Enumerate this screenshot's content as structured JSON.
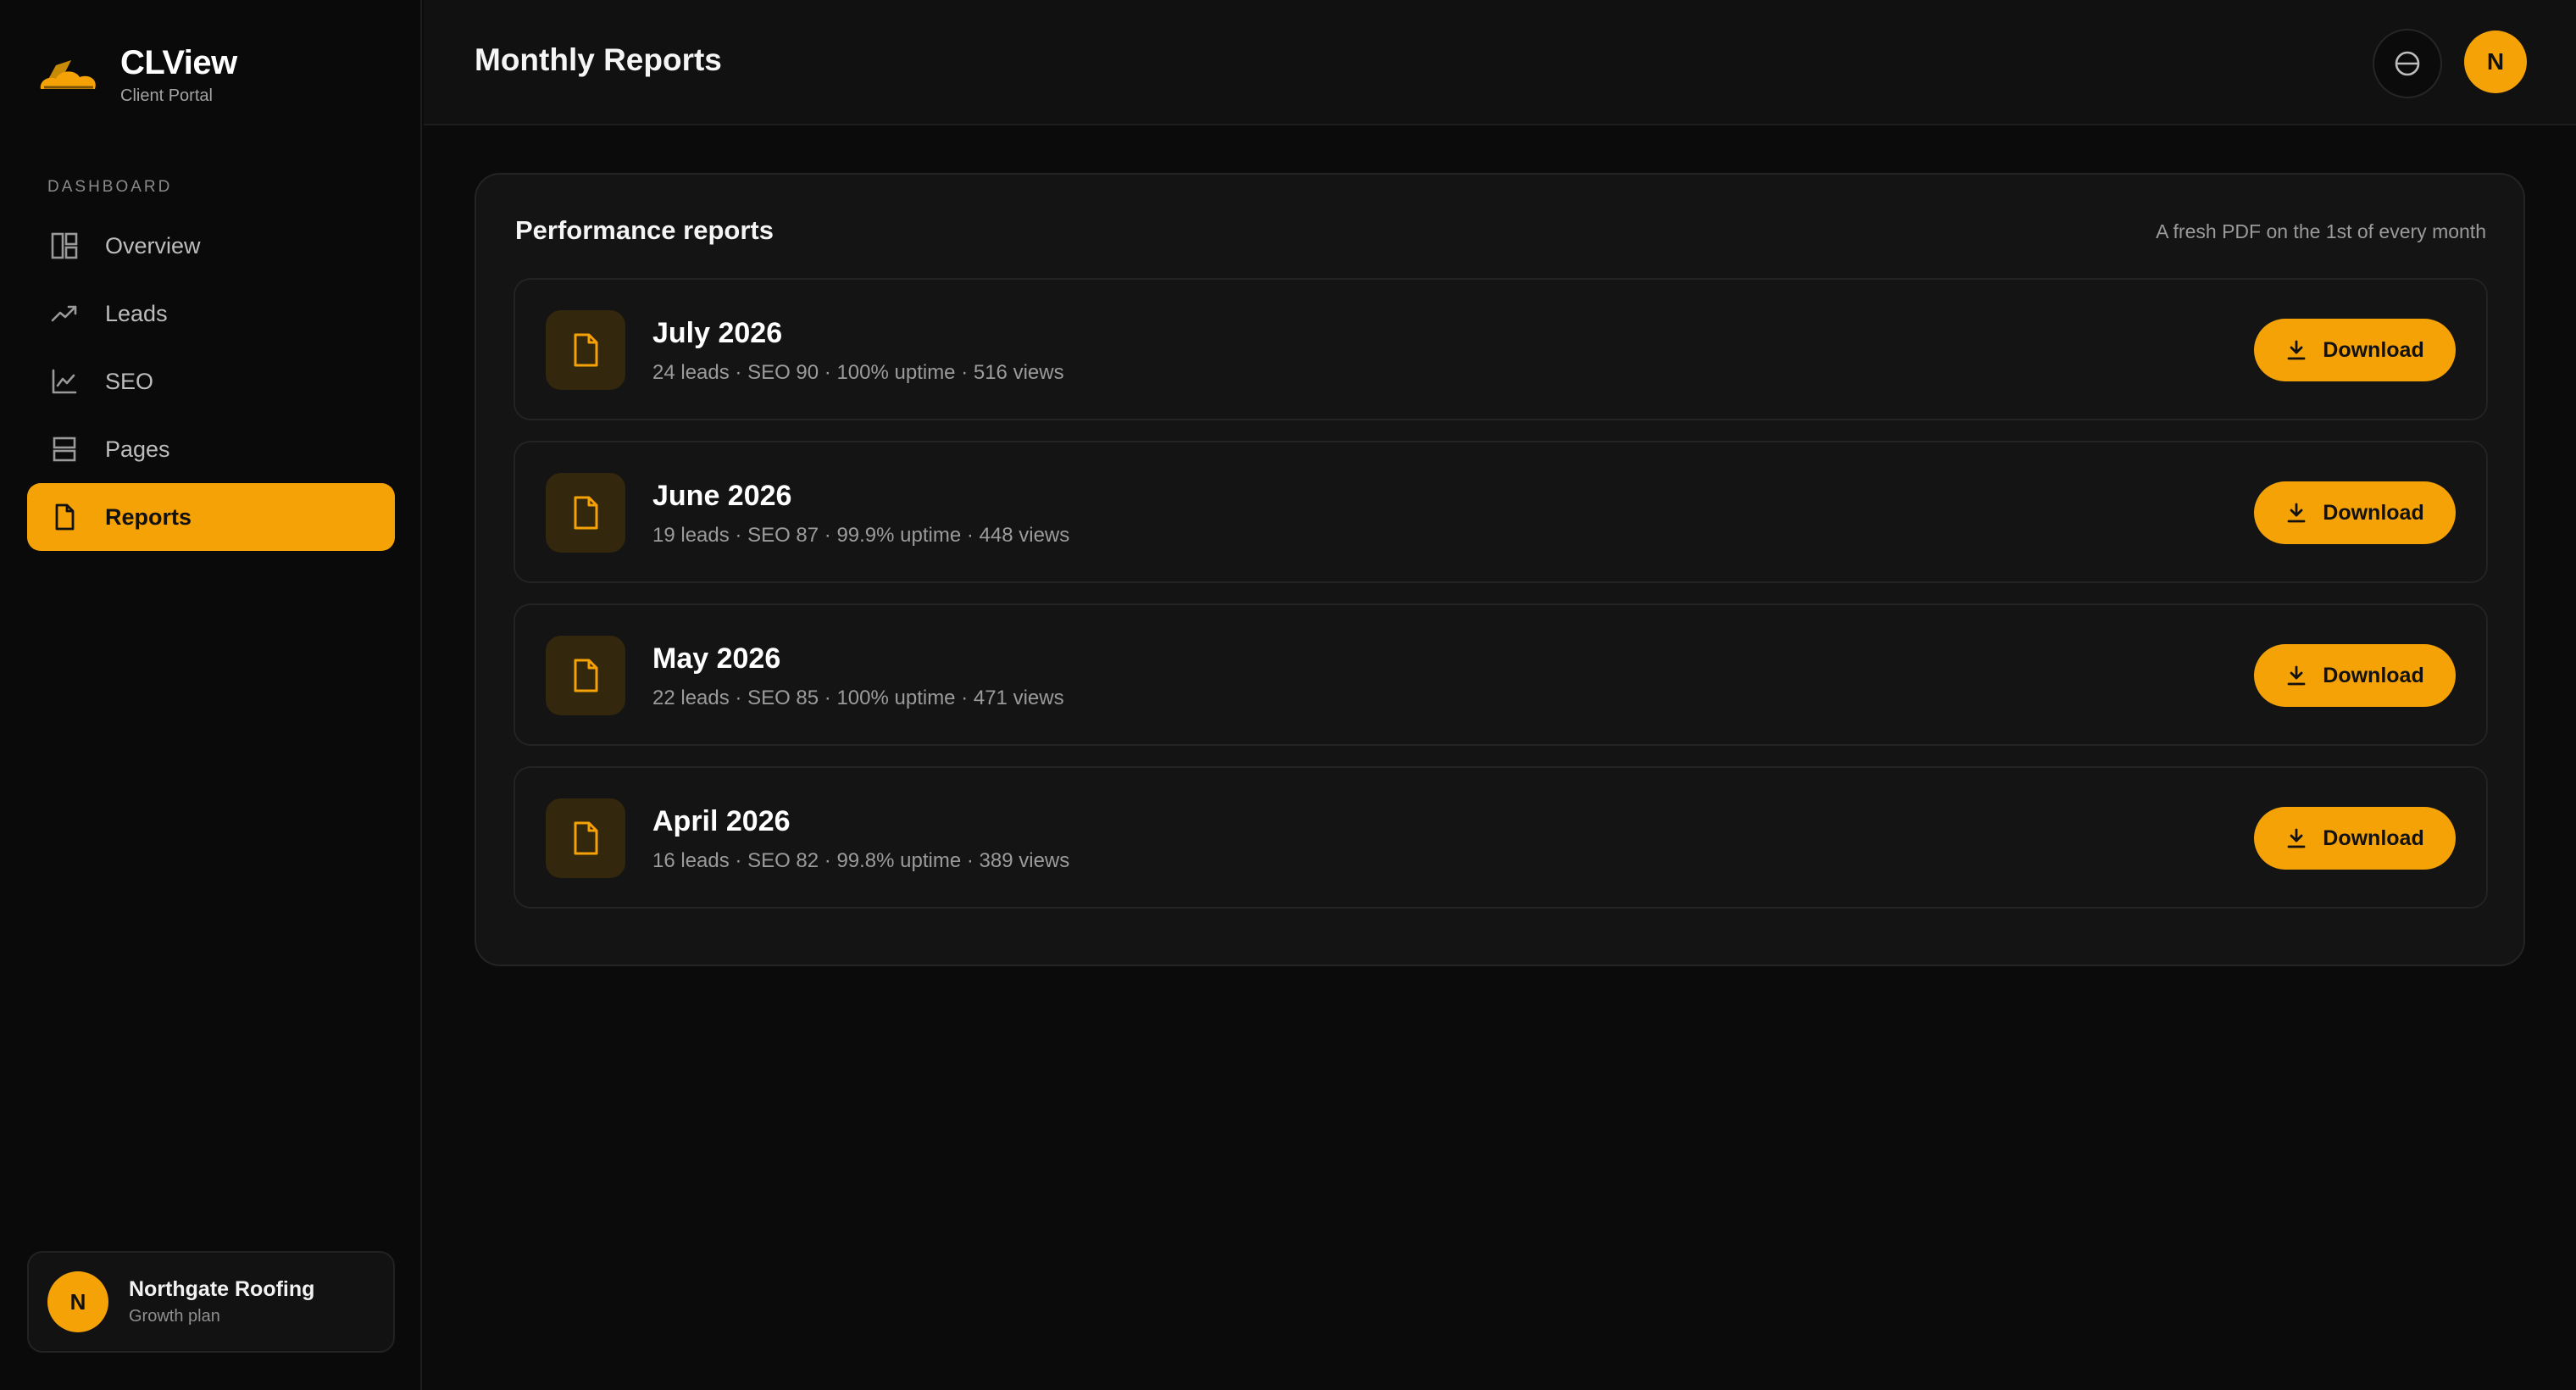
{
  "brand": {
    "name": "CLView",
    "subtitle": "Client Portal"
  },
  "sidebar": {
    "section_label": "DASHBOARD",
    "items": [
      {
        "label": "Overview",
        "icon": "layout-icon",
        "active": false
      },
      {
        "label": "Leads",
        "icon": "trending-up-icon",
        "active": false
      },
      {
        "label": "SEO",
        "icon": "line-chart-icon",
        "active": false
      },
      {
        "label": "Pages",
        "icon": "pages-icon",
        "active": false
      },
      {
        "label": "Reports",
        "icon": "file-icon",
        "active": true
      }
    ],
    "account": {
      "initial": "N",
      "name": "Northgate Roofing",
      "plan": "Growth plan"
    }
  },
  "header": {
    "title": "Monthly Reports",
    "theme_icon": "contrast-icon",
    "user_initial": "N"
  },
  "panel": {
    "title": "Performance reports",
    "note": "A fresh PDF on the 1st of every month",
    "download_label": "Download",
    "reports": [
      {
        "title": "July 2026",
        "meta": "24 leads · SEO 90 · 100% uptime · 516 views"
      },
      {
        "title": "June 2026",
        "meta": "19 leads · SEO 87 · 99.9% uptime · 448 views"
      },
      {
        "title": "May 2026",
        "meta": "22 leads · SEO 85 · 100% uptime · 471 views"
      },
      {
        "title": "April 2026",
        "meta": "16 leads · SEO 82 · 99.8% uptime · 389 views"
      }
    ]
  },
  "colors": {
    "accent": "#f5a207",
    "background": "#0b0b0b",
    "card": "#141414"
  }
}
